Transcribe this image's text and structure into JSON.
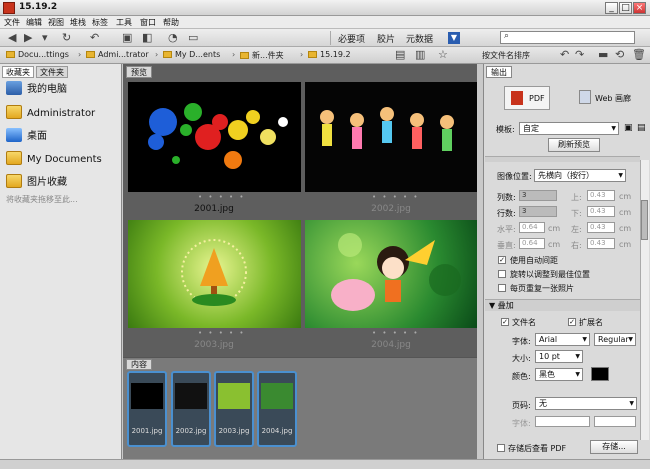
{
  "window": {
    "title": "15.19.2"
  },
  "menu": [
    "文件",
    "编辑",
    "视图",
    "堆栈",
    "标签",
    "工具",
    "窗口",
    "帮助"
  ],
  "toolbar": {
    "btn_essentials": "必要项",
    "btn_filmstrip": "胶片",
    "btn_metadata": "元数据",
    "search_placeholder": ""
  },
  "path": {
    "crumbs": [
      "Docu...ttings",
      "Admi...trator",
      "My D...ents",
      "新...件夹",
      "15.19.2"
    ],
    "sort_label": "按文件名排序"
  },
  "left_panel": {
    "tab_favorites": "收藏夹",
    "tab_folders": "文件夹",
    "items": [
      "我的电脑",
      "Administrator",
      "桌面",
      "My Documents",
      "图片收藏"
    ],
    "hint": "将收藏夹拖移至此..."
  },
  "preview": {
    "tab": "预览",
    "thumbs": [
      {
        "name": "2001.jpg",
        "dots": "• • • • •"
      },
      {
        "name": "2002.jpg",
        "dots": "• • • • •"
      },
      {
        "name": "2003.jpg",
        "dots": "• • • • •"
      },
      {
        "name": "2004.jpg",
        "dots": "• • • • •"
      }
    ]
  },
  "content": {
    "tab": "内容",
    "files": [
      "2001.jpg",
      "2002.jpg",
      "2003.jpg",
      "2004.jpg"
    ]
  },
  "output": {
    "tab": "输出",
    "btn_pdf": "PDF",
    "btn_web": "Web 画廊",
    "template_label": "模板:",
    "template_value": "自定",
    "refresh": "刷新预览",
    "layout_position_label": "图像位置:",
    "layout_position_value": "先横向（按行）",
    "cols_label": "列数:",
    "cols_value": "3",
    "rows_label": "行数:",
    "rows_value": "3",
    "top_label": "上:",
    "top_value": "0.43",
    "bottom_label": "下:",
    "bottom_value": "0.43",
    "left_label": "左:",
    "left_value": "0.43",
    "right_label": "右:",
    "right_value": "0.43",
    "hspace_label": "水平:",
    "hspace_value": "0.64",
    "vspace_label": "垂直:",
    "vspace_value": "0.64",
    "unit": "cm",
    "auto_spacing": "使用自动间距",
    "rotate_best": "旋转以调整到最佳位置",
    "repeat_one": "每页重复一张照片",
    "overlay_header": "叠加",
    "filename": "文件名",
    "extension": "扩展名",
    "font_label": "字体:",
    "font_value": "Arial",
    "font_style": "Regular",
    "size_label": "大小:",
    "size_value": "10 pt",
    "color_label": "颜色:",
    "color_value": "黑色",
    "page_num_label": "页码:",
    "page_num_value": "无",
    "font2_label": "字体:",
    "view_after_save": "存储后查看 PDF",
    "save_btn": "存储..."
  },
  "colors": {
    "accent_blue": "#4a90d0",
    "panel_dark": "#5e5e5e",
    "folder": "#e8b531"
  }
}
